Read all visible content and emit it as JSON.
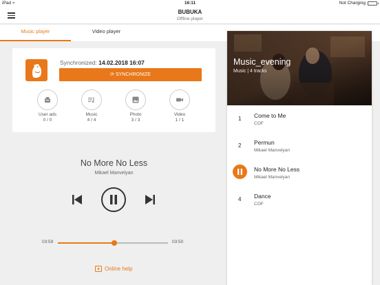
{
  "status_bar": {
    "device": "iPad",
    "time": "16:11",
    "charging": "Not Charging"
  },
  "header": {
    "title": "BUBUKA",
    "subtitle": "Offline player"
  },
  "tabs": [
    {
      "label": "Music player",
      "active": true
    },
    {
      "label": "Video player",
      "active": false
    }
  ],
  "sync": {
    "label": "Synchronized:",
    "datetime": "14.02.2018 16:07",
    "button_label": "SYNCHRONIZE"
  },
  "stats": [
    {
      "label": "User ads",
      "count": "0 / 0",
      "icon": "user-ads-icon"
    },
    {
      "label": "Music",
      "count": "4 / 4",
      "icon": "music-list-icon"
    },
    {
      "label": "Photo",
      "count": "3 / 3",
      "icon": "photo-icon"
    },
    {
      "label": "Video",
      "count": "1 / 1",
      "icon": "video-camera-icon"
    }
  ],
  "now_playing": {
    "title": "No More No Less",
    "artist": "Mikael Manvelyan",
    "elapsed": "03:59",
    "remaining": "03:50",
    "progress": 0.51
  },
  "help": {
    "label": "Online help"
  },
  "playlist": {
    "title": "Music_evening",
    "subtitle": "Music | 4 tracks",
    "tracks": [
      {
        "number": "1",
        "title": "Come to Me",
        "artist": "COF",
        "playing": false
      },
      {
        "number": "2",
        "title": "Permun",
        "artist": "Mikael Manvelyan",
        "playing": false
      },
      {
        "number": "3",
        "title": "No More No Less",
        "artist": "Mikael Manvelyan",
        "playing": true
      },
      {
        "number": "4",
        "title": "Dance",
        "artist": "COF",
        "playing": false
      }
    ]
  },
  "colors": {
    "accent": "#e8781a",
    "background": "#efefef",
    "card": "#ffffff"
  }
}
